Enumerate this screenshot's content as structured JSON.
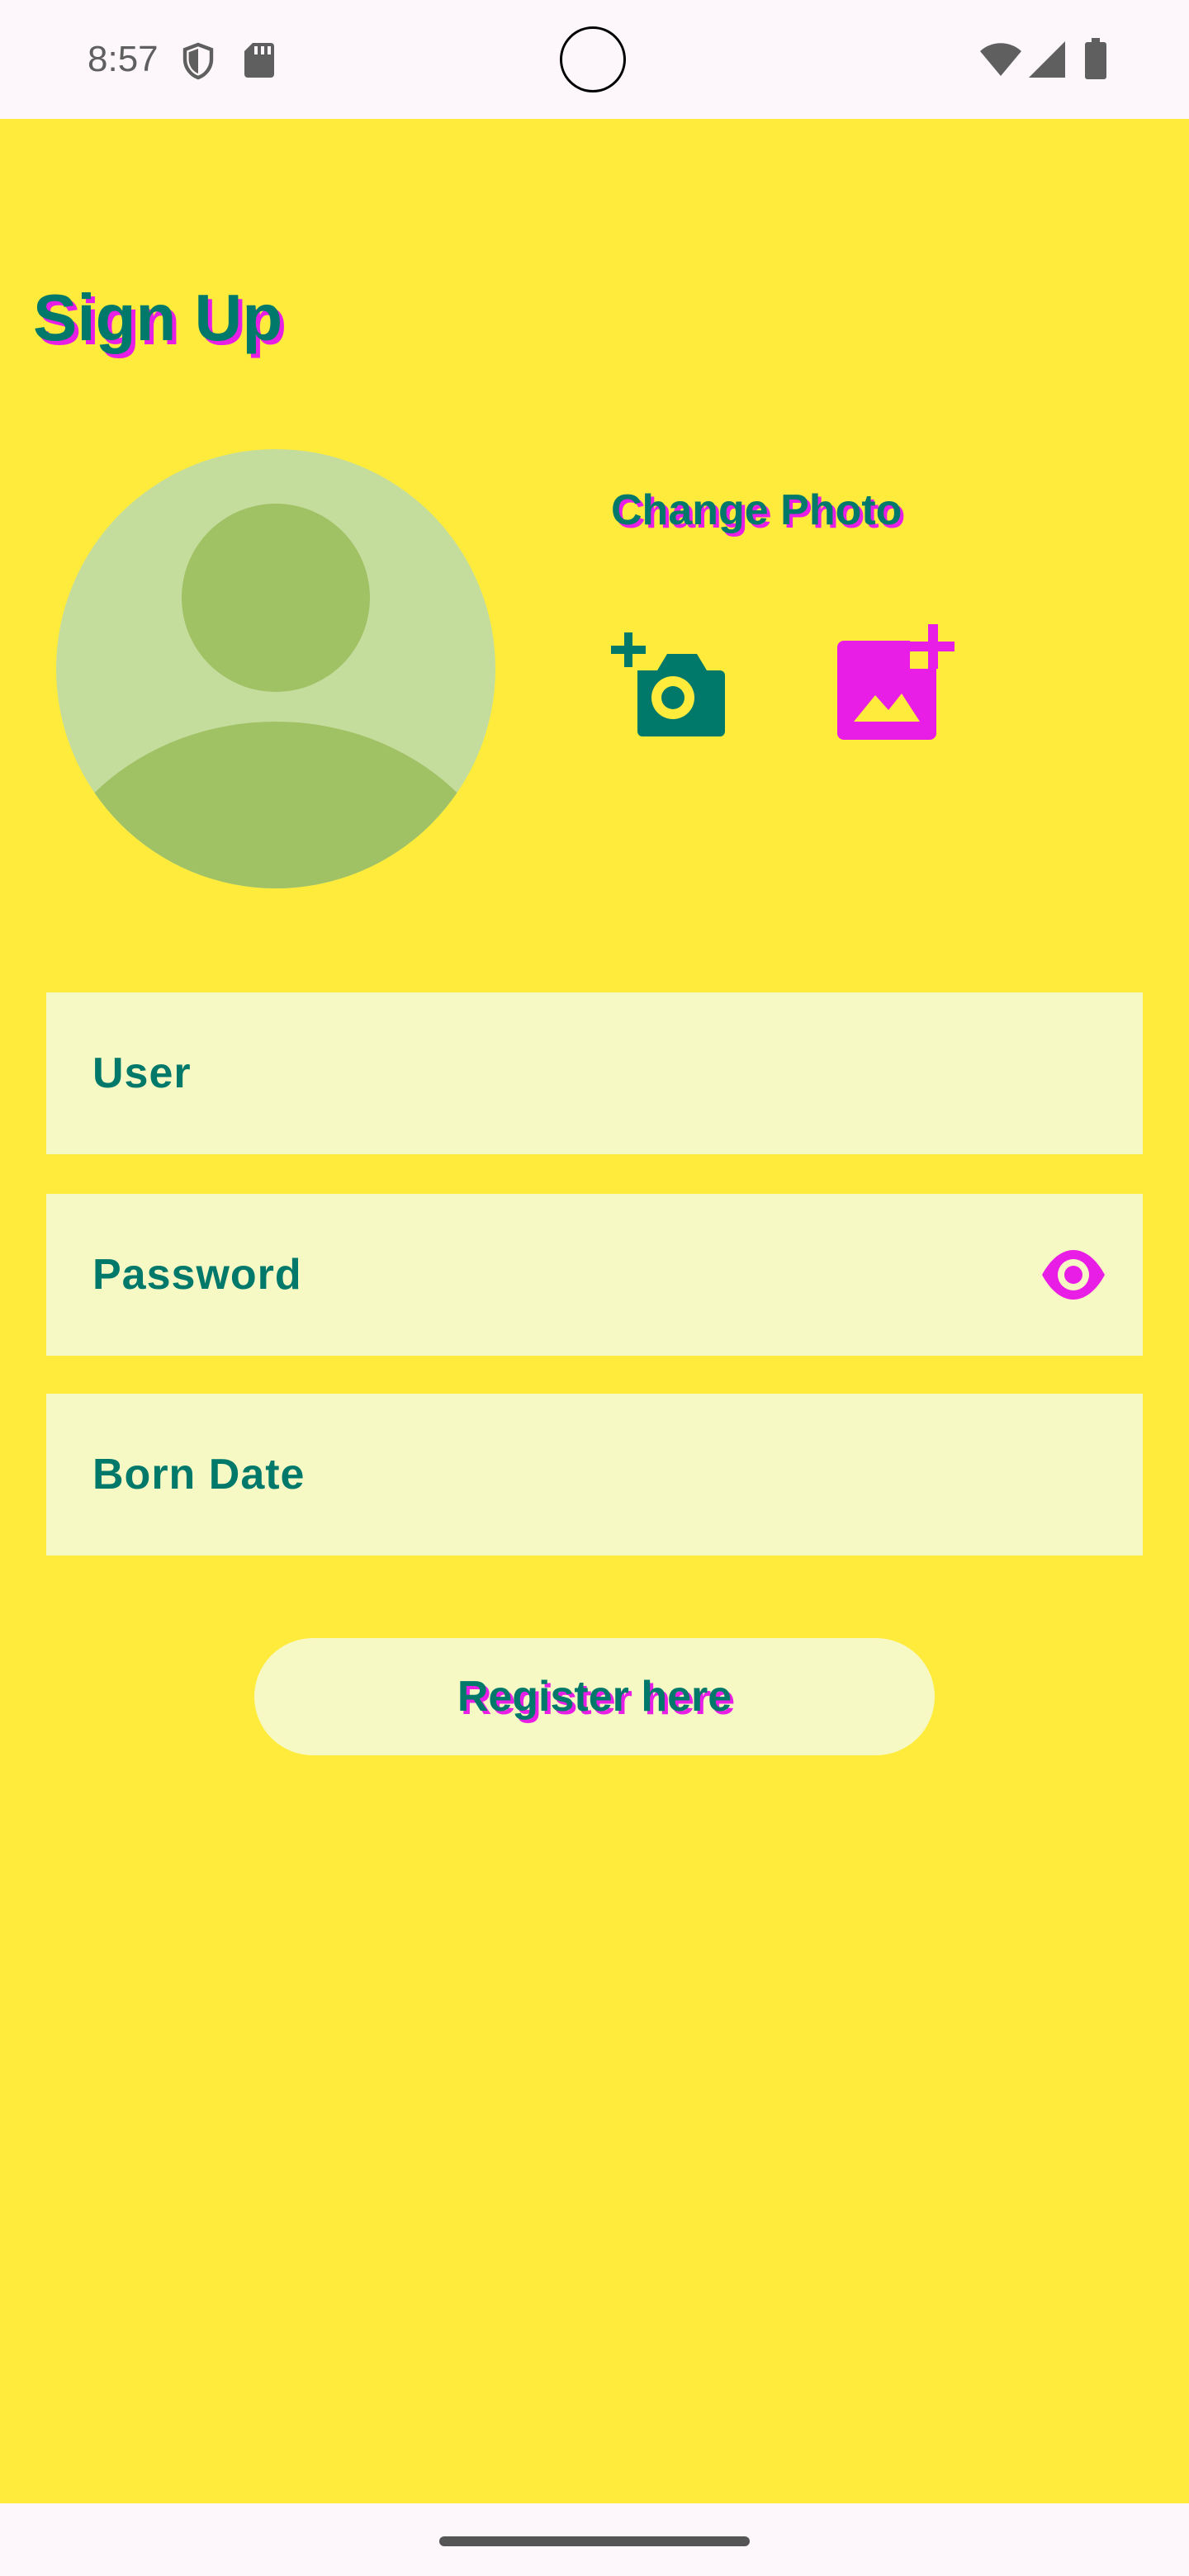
{
  "status_bar": {
    "time": "8:57",
    "icons_left": [
      "shield-icon",
      "sd-card-icon"
    ],
    "icons_right": [
      "wifi-icon",
      "cell-signal-icon",
      "battery-icon"
    ]
  },
  "colors": {
    "background": "#FFEB3B",
    "field_background": "#F7F9C4",
    "primary_teal": "#00796B",
    "accent_magenta": "#E91EE6",
    "avatar_light": "#C5DD9C",
    "avatar_dark": "#A1C165"
  },
  "header": {
    "title": "Sign Up"
  },
  "photo": {
    "avatar_icon": "person-avatar-icon",
    "change_label": "Change Photo",
    "camera_icon": "add-camera-icon",
    "gallery_icon": "add-photo-icon"
  },
  "form": {
    "user_label": "User",
    "password_label": "Password",
    "password_toggle_icon": "eye-icon",
    "born_date_label": "Born Date"
  },
  "actions": {
    "register_label": "Register here"
  }
}
